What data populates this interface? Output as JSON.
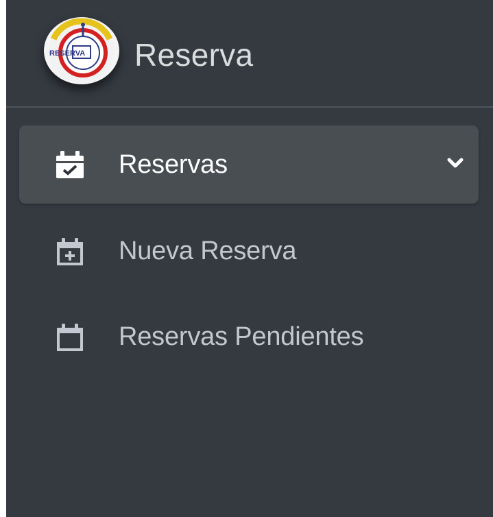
{
  "brand": {
    "title": "Reserva",
    "logo_text": "RESERVA",
    "logo_icon": "reserva-logo"
  },
  "sidebar": {
    "items": [
      {
        "label": "Reservas",
        "icon": "calendar-check-icon",
        "active": true,
        "has_submenu": true,
        "toggle_icon": "chevron-down-icon"
      },
      {
        "label": "Nueva Reserva",
        "icon": "calendar-plus-icon",
        "active": false
      },
      {
        "label": "Reservas Pendientes",
        "icon": "calendar-icon",
        "active": false
      }
    ]
  },
  "colors": {
    "sidebar_bg": "#343a40",
    "active_bg": "#494e53",
    "text": "#c2c7d0",
    "active_text": "#ffffff",
    "divider": "#4b545c"
  }
}
